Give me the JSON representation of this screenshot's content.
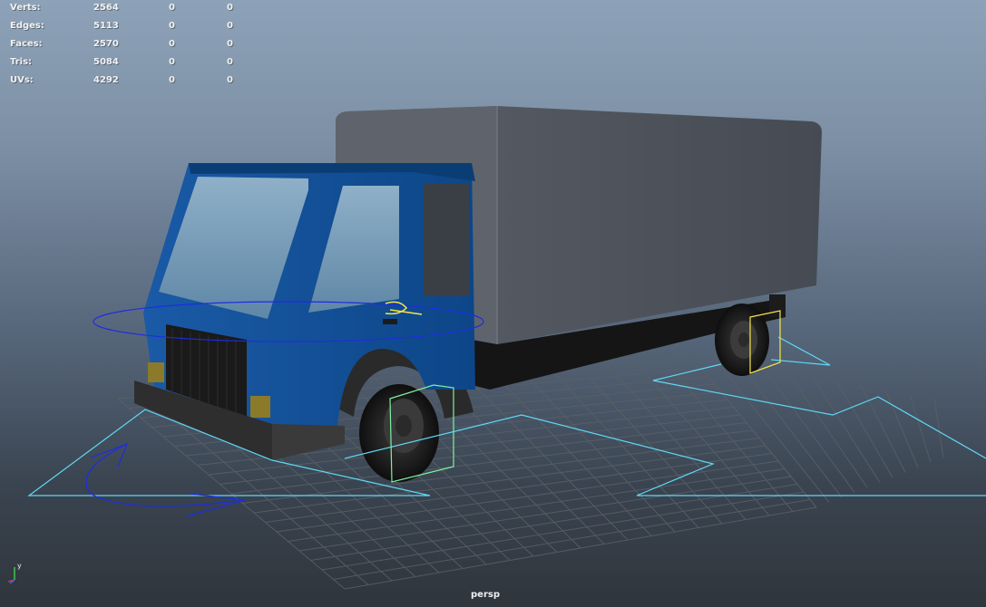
{
  "hud": {
    "rows": [
      {
        "label": "Verts:",
        "value": "2564",
        "c2": "0",
        "c3": "0"
      },
      {
        "label": "Edges:",
        "value": "5113",
        "c2": "0",
        "c3": "0"
      },
      {
        "label": "Faces:",
        "value": "2570",
        "c2": "0",
        "c3": "0"
      },
      {
        "label": "Tris:",
        "value": "5084",
        "c2": "0",
        "c3": "0"
      },
      {
        "label": "UVs:",
        "value": "4292",
        "c2": "0",
        "c3": "0"
      }
    ]
  },
  "camera": {
    "name": "persp"
  },
  "axis_indicator": {
    "y_label": "y",
    "x_color": "#e23a3a",
    "y_color": "#42d24a",
    "z_color": "#3a6ce2"
  },
  "colors": {
    "cab": "#0f4e96",
    "box": "#4b5059",
    "control_curve": "#5fd8f5",
    "rotate_handle": "#1e2de0",
    "selection_yellow": "#f4e54a",
    "selection_green": "#7ef0a0"
  }
}
